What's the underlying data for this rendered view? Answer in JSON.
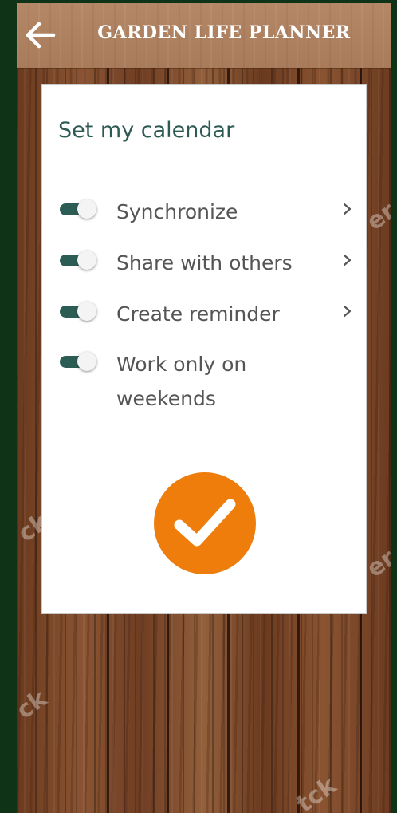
{
  "header": {
    "title": "GARDEN LIFE PLANNER",
    "back_icon": "arrow-left-icon"
  },
  "card": {
    "title": "Set my calendar",
    "settings": [
      {
        "label": "Synchronize",
        "enabled": true,
        "has_chevron": true
      },
      {
        "label": "Share with others",
        "enabled": true,
        "has_chevron": true
      },
      {
        "label": "Create reminder",
        "enabled": true,
        "has_chevron": true
      },
      {
        "label": "Work only on weekends",
        "enabled": true,
        "has_chevron": false
      }
    ],
    "confirm_icon": "checkmark-icon"
  },
  "colors": {
    "background": "#0f3316",
    "header": "#a87c5b",
    "toggle_track": "#2b5d55",
    "title_text": "#2f5a53",
    "label_text": "#555555",
    "confirm_button": "#ef7d0c"
  }
}
